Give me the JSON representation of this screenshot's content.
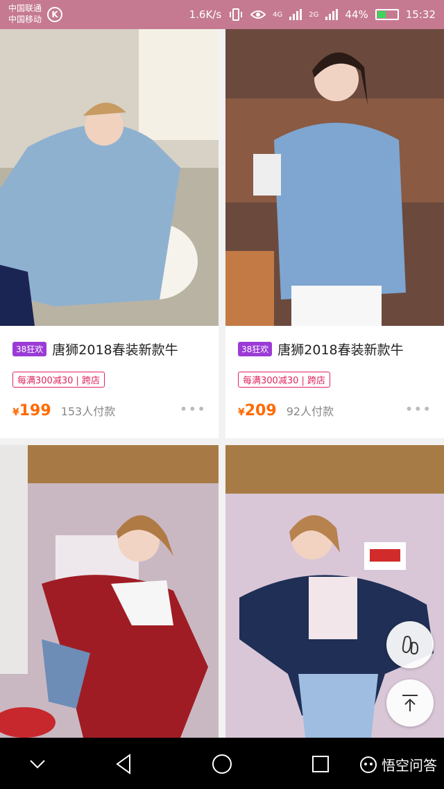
{
  "status_bar": {
    "carrier_1": "中国联通",
    "carrier_2": "中国移动",
    "k_icon_label": "K",
    "net_speed": "1.6K/s",
    "signal_label": "4G",
    "signal2_label": "2G",
    "battery_pct": "44%",
    "battery_level": 0.44,
    "time": "15:32",
    "colors": {
      "bar": "#c57a92"
    }
  },
  "products": [
    {
      "tag": "38狂欢",
      "title": "唐狮2018春装新款牛",
      "promo": "每满300减30 | 跨店",
      "currency": "¥",
      "price": "199",
      "sold": "153人付款",
      "more": "•••",
      "colors": {
        "jacket": "#8fb1d0",
        "bg": "#d8d1c5"
      }
    },
    {
      "tag": "38狂欢",
      "title": "唐狮2018春装新款牛",
      "promo": "每满300减30 | 跨店",
      "currency": "¥",
      "price": "209",
      "sold": "92人付款",
      "more": "•••",
      "colors": {
        "jacket": "#7ea6d1",
        "bg": "#6b4a3d"
      }
    },
    {
      "colors": {
        "jacket": "#a01c24",
        "bg": "#c9b8c2"
      }
    },
    {
      "colors": {
        "jacket": "#1f2f55",
        "bg": "#d9c7d8"
      }
    }
  ],
  "fabs": {
    "footprint_icon": "footprint-icon",
    "top_icon": "back-to-top-icon"
  },
  "nav": {
    "watermark": "悟空问答",
    "icons": [
      "chevron-down-icon",
      "back-triangle-icon",
      "home-circle-icon",
      "recents-square-icon"
    ]
  },
  "colors": {
    "accent_price": "#ff6a00",
    "promo": "#e0245e",
    "tag": "#9b3bd6"
  }
}
